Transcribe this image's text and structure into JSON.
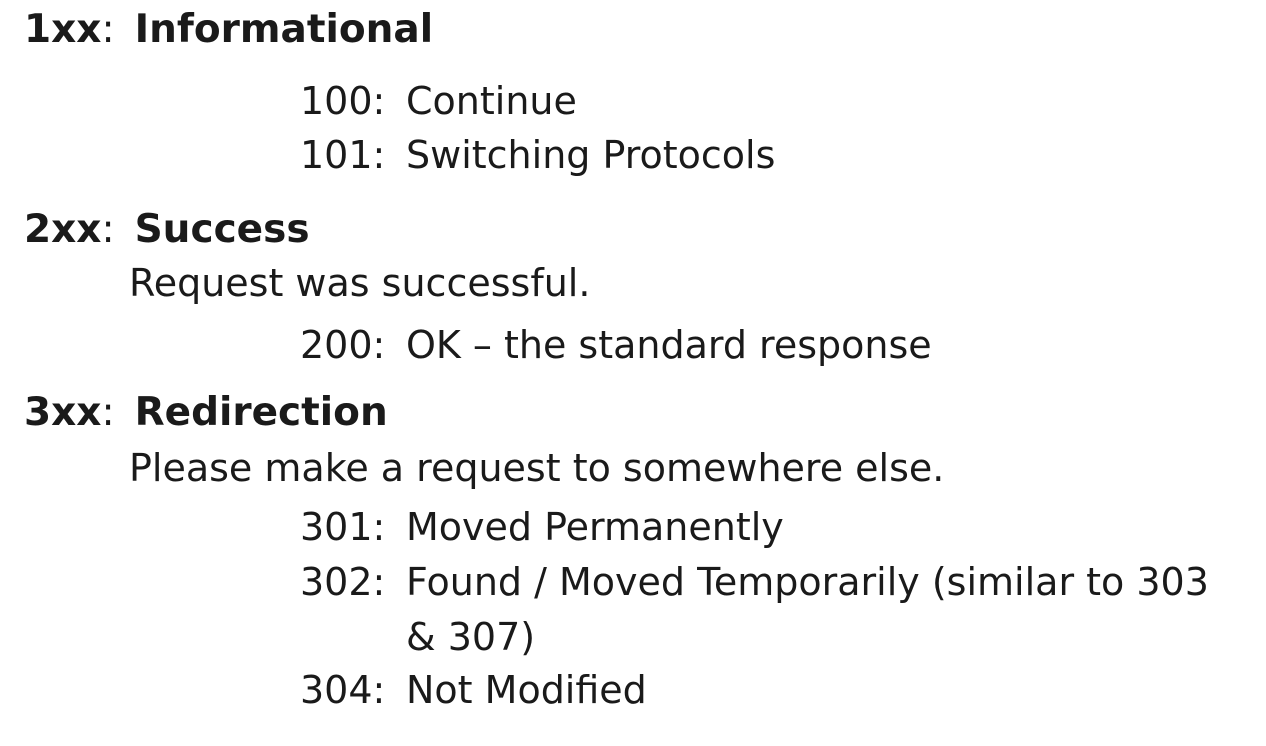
{
  "classes": [
    {
      "code": "1xx",
      "title": "Informational",
      "description": "",
      "statuses": [
        {
          "code": "100:",
          "text": "Continue"
        },
        {
          "code": "101:",
          "text": "Switching Protocols"
        }
      ]
    },
    {
      "code": "2xx",
      "title": "Success",
      "description": "Request was successful.",
      "statuses": [
        {
          "code": "200:",
          "text": "OK – the standard response"
        }
      ]
    },
    {
      "code": "3xx",
      "title": "Redirection",
      "description": "Please make a request to somewhere else.",
      "statuses": [
        {
          "code": "301:",
          "text": "Moved Permanently"
        },
        {
          "code": "302:",
          "text": "Found / Moved Temporarily (similar to 303 & 307)"
        },
        {
          "code": "304:",
          "text": "Not Modified"
        }
      ]
    }
  ]
}
